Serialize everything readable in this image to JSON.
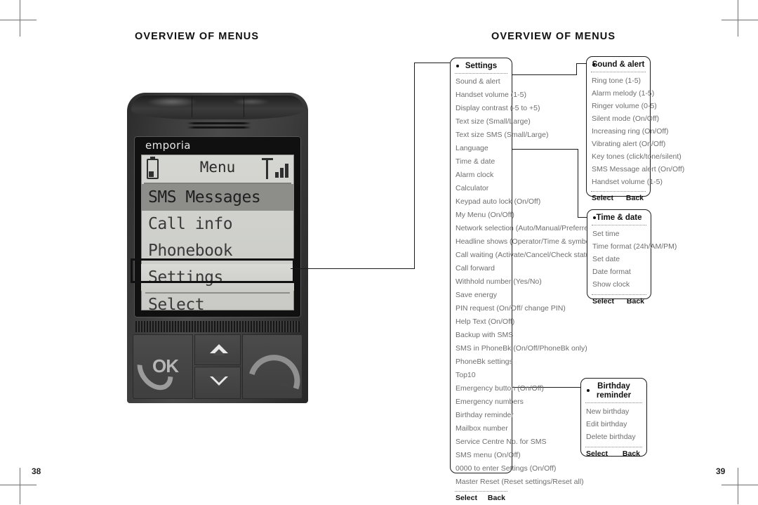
{
  "document": {
    "left_page_heading": "OVERVIEW OF MENUS",
    "right_page_heading": "OVERVIEW OF MENUS",
    "left_page_number": "38",
    "right_page_number": "39"
  },
  "phone": {
    "brand": "emporia",
    "screen": {
      "title": "Menu",
      "battery_icon": "battery-icon",
      "signal_icon": "signal-strength-icon",
      "items": [
        {
          "label": "SMS Messages",
          "state": "selected"
        },
        {
          "label": "Call info",
          "state": "normal"
        },
        {
          "label": "Phonebook",
          "state": "normal"
        },
        {
          "label": "Settings",
          "state": "highlighted"
        }
      ],
      "softkey": "Select"
    },
    "keys": {
      "ok_label": "OK",
      "call_icon": "handset-call-icon",
      "end_call_icon": "end-call-icon",
      "up_icon": "chevron-up-icon",
      "down_icon": "chevron-down-icon"
    }
  },
  "boxes": {
    "settings": {
      "title": "Settings",
      "items": [
        "Sound & alert",
        "Handset volume (1-5)",
        "Display contrast (-5 to +5)",
        "Text size (Small/Large)",
        "Text size SMS (Small/Large)",
        "Language",
        "Time & date",
        "Alarm clock",
        "Calculator",
        "Keypad auto lock (On/Off)",
        "My Menu (On/Off)",
        "Network selection (Auto/Manual/Preferred)",
        "Headline shows (Operator/Time & symbol)",
        "Call waiting (Activate/Cancel/Check status)",
        "Call forward",
        "Withhold number (Yes/No)",
        "Save energy",
        "PIN request (On/Off/ change PIN)",
        "Help Text (On/Off)",
        "Backup with SMS",
        "SMS in PhoneBk (On/Off/PhoneBk only)",
        "PhoneBk settings",
        "Top10",
        "Emergency button (On/Off)",
        "Emergency numbers",
        "Birthday reminder",
        "Mailbox number",
        "Service Centre No. for SMS",
        "SMS menu (On/Off)",
        "0000 to enter Settings (On/Off)",
        "Master Reset (Reset settings/Reset all)"
      ],
      "softkey_left": "Select",
      "softkey_right": "Back"
    },
    "sound_alert": {
      "title": "Sound & alert",
      "items": [
        "Ring tone (1-5)",
        "Alarm melody (1-5)",
        "Ringer volume (0-5)",
        "Silent mode (On/Off)",
        "Increasing ring (On/Off)",
        "Vibrating alert (On/Off)",
        "Key tones (click/tone/silent)",
        "SMS Message alert (On/Off)",
        "Handset volume (1-5)"
      ],
      "softkey_left": "Select",
      "softkey_right": "Back"
    },
    "time_date": {
      "title": "Time & date",
      "items": [
        "Set time",
        "Time format (24h/AM/PM)",
        "Set date",
        "Date format",
        "Show clock"
      ],
      "softkey_left": "Select",
      "softkey_right": "Back"
    },
    "birthday_reminder": {
      "title_line1": "Birthday",
      "title_line2": "reminder",
      "items": [
        "New birthday",
        "Edit birthday",
        "Delete birthday"
      ],
      "softkey_left": "Select",
      "softkey_right": "Back"
    }
  }
}
